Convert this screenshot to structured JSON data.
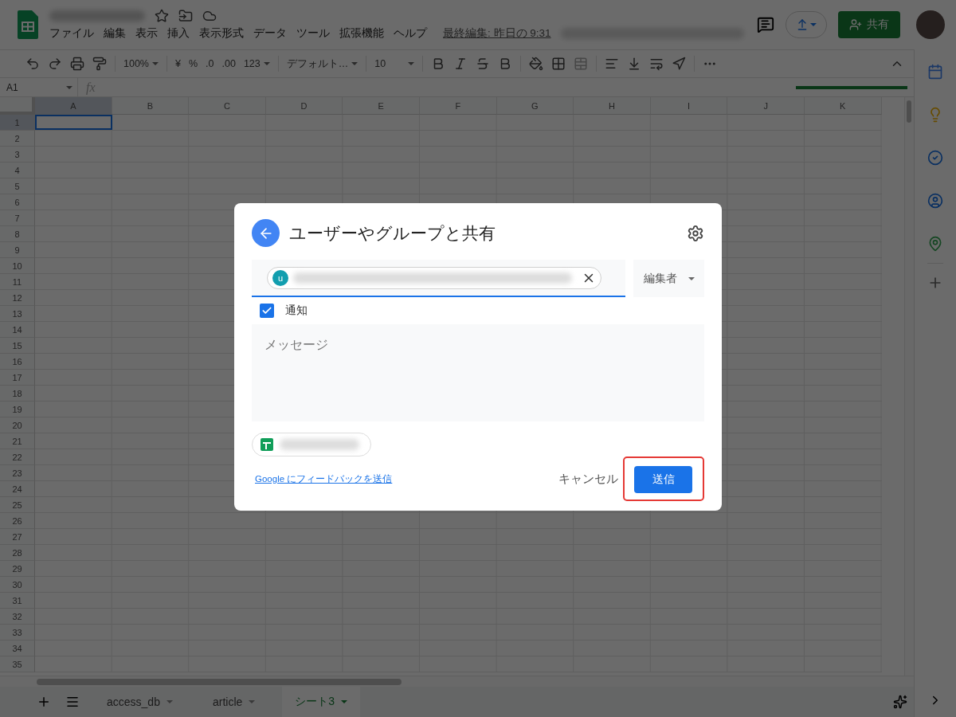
{
  "header": {
    "menu": [
      "ファイル",
      "編集",
      "表示",
      "挿入",
      "表示形式",
      "データ",
      "ツール",
      "拡張機能",
      "ヘルプ"
    ],
    "last_edit": "最終編集: 昨日の 9:31",
    "share_button": "共有"
  },
  "toolbar": {
    "zoom": "100%",
    "currency": "¥",
    "percent": "%",
    "decrease_decimal": ".0",
    "increase_decimal": ".00",
    "number_format": "123",
    "font": "デフォルト…",
    "font_size": "10"
  },
  "formula_bar": {
    "name_box": "A1",
    "fx": "fx"
  },
  "grid": {
    "columns": [
      {
        "label": "A",
        "selected": true
      },
      {
        "label": "B",
        "selected": false
      },
      {
        "label": "C",
        "selected": false
      },
      {
        "label": "D",
        "selected": false
      },
      {
        "label": "E",
        "selected": false
      },
      {
        "label": "F",
        "selected": false
      },
      {
        "label": "G",
        "selected": false
      },
      {
        "label": "H",
        "selected": false
      },
      {
        "label": "I",
        "selected": false
      },
      {
        "label": "J",
        "selected": false
      },
      {
        "label": "K",
        "selected": false
      }
    ],
    "rows": [
      {
        "label": "1",
        "selected": true
      },
      {
        "label": "2",
        "selected": false
      },
      {
        "label": "3",
        "selected": false
      },
      {
        "label": "4",
        "selected": false
      },
      {
        "label": "5",
        "selected": false
      },
      {
        "label": "6",
        "selected": false
      },
      {
        "label": "7",
        "selected": false
      },
      {
        "label": "8",
        "selected": false
      },
      {
        "label": "9",
        "selected": false
      },
      {
        "label": "10",
        "selected": false
      },
      {
        "label": "11",
        "selected": false
      },
      {
        "label": "12",
        "selected": false
      },
      {
        "label": "13",
        "selected": false
      },
      {
        "label": "14",
        "selected": false
      },
      {
        "label": "15",
        "selected": false
      },
      {
        "label": "16",
        "selected": false
      },
      {
        "label": "17",
        "selected": false
      },
      {
        "label": "18",
        "selected": false
      },
      {
        "label": "19",
        "selected": false
      },
      {
        "label": "20",
        "selected": false
      },
      {
        "label": "21",
        "selected": false
      },
      {
        "label": "22",
        "selected": false
      },
      {
        "label": "23",
        "selected": false
      },
      {
        "label": "24",
        "selected": false
      },
      {
        "label": "25",
        "selected": false
      },
      {
        "label": "26",
        "selected": false
      },
      {
        "label": "27",
        "selected": false
      },
      {
        "label": "28",
        "selected": false
      },
      {
        "label": "29",
        "selected": false
      },
      {
        "label": "30",
        "selected": false
      },
      {
        "label": "31",
        "selected": false
      },
      {
        "label": "32",
        "selected": false
      },
      {
        "label": "33",
        "selected": false
      },
      {
        "label": "34",
        "selected": false
      },
      {
        "label": "35",
        "selected": false
      }
    ]
  },
  "sheet_tabs": [
    {
      "label": "access_db",
      "selected": false
    },
    {
      "label": "article",
      "selected": false
    },
    {
      "label": "シート3",
      "selected": true
    }
  ],
  "dialog": {
    "title": "ユーザーやグループと共有",
    "recipient_initial": "u",
    "role": "編集者",
    "notify": {
      "label": "通知",
      "checked": true
    },
    "message_placeholder": "メッセージ",
    "feedback_link": "Google にフィードバックを送信",
    "cancel": "キャンセル",
    "send": "送信"
  }
}
